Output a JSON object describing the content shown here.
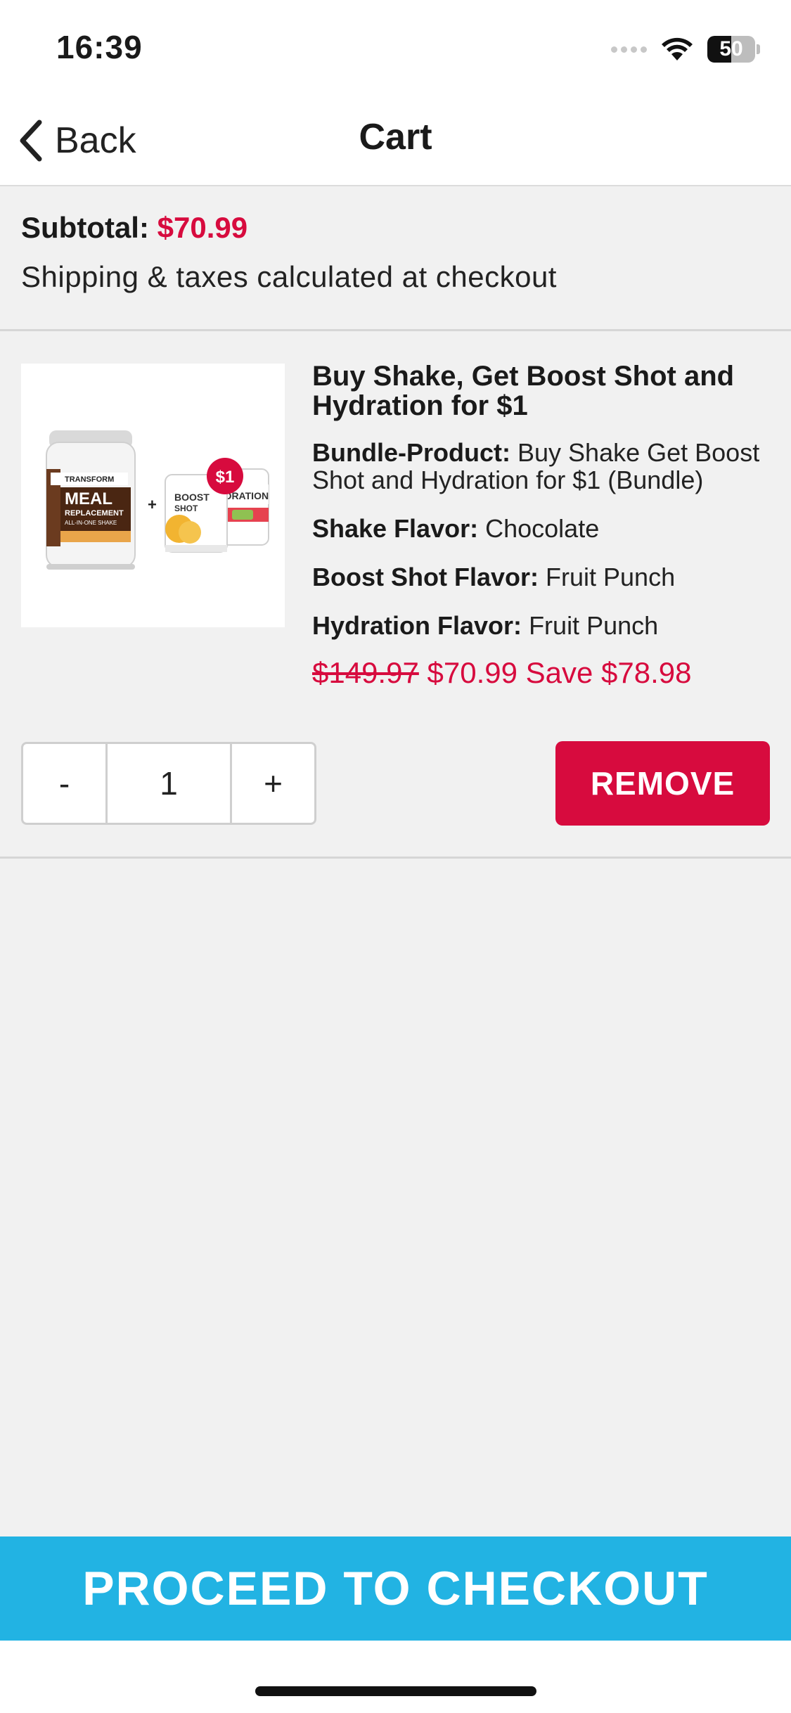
{
  "status_bar": {
    "time": "16:39",
    "battery": "50",
    "battery_level": 0.5
  },
  "nav": {
    "back_label": "Back",
    "title": "Cart"
  },
  "summary": {
    "subtotal_label": "Subtotal:",
    "subtotal_value": "$70.99",
    "shipping_note": "Shipping & taxes calculated at checkout"
  },
  "cart_item": {
    "title": "Buy Shake, Get Boost Shot and Hydration for $1",
    "image_badge": "$1",
    "image_text": {
      "brand": "TRANSFORM",
      "meal": "MEAL",
      "replacement": "REPLACEMENT",
      "sub": "ALL-IN-ONE SHAKE",
      "boost": "BOOST",
      "shot": "SHOT",
      "hydration": "YDRATION"
    },
    "attributes": [
      {
        "label": "Bundle-Product:",
        "value": "Buy Shake Get Boost Shot and Hydration for $1 (Bundle)"
      },
      {
        "label": "Shake Flavor:",
        "value": "Chocolate"
      },
      {
        "label": "Boost Shot Flavor:",
        "value": "Fruit Punch"
      },
      {
        "label": "Hydration Flavor:",
        "value": "Fruit Punch"
      }
    ],
    "original_price": "$149.97",
    "price": "$70.99",
    "savings": "Save $78.98",
    "quantity": "1",
    "decrement_label": "-",
    "increment_label": "+",
    "remove_label": "REMOVE"
  },
  "checkout": {
    "label": "PROCEED TO CHECKOUT"
  },
  "colors": {
    "accent_red": "#d70b3e",
    "checkout_blue": "#22b3e3",
    "background": "#f1f1f1"
  },
  "icons": {
    "back": "chevron-left-icon",
    "wifi": "wifi-icon",
    "signal": "cellular-signal-icon",
    "battery": "battery-icon"
  }
}
